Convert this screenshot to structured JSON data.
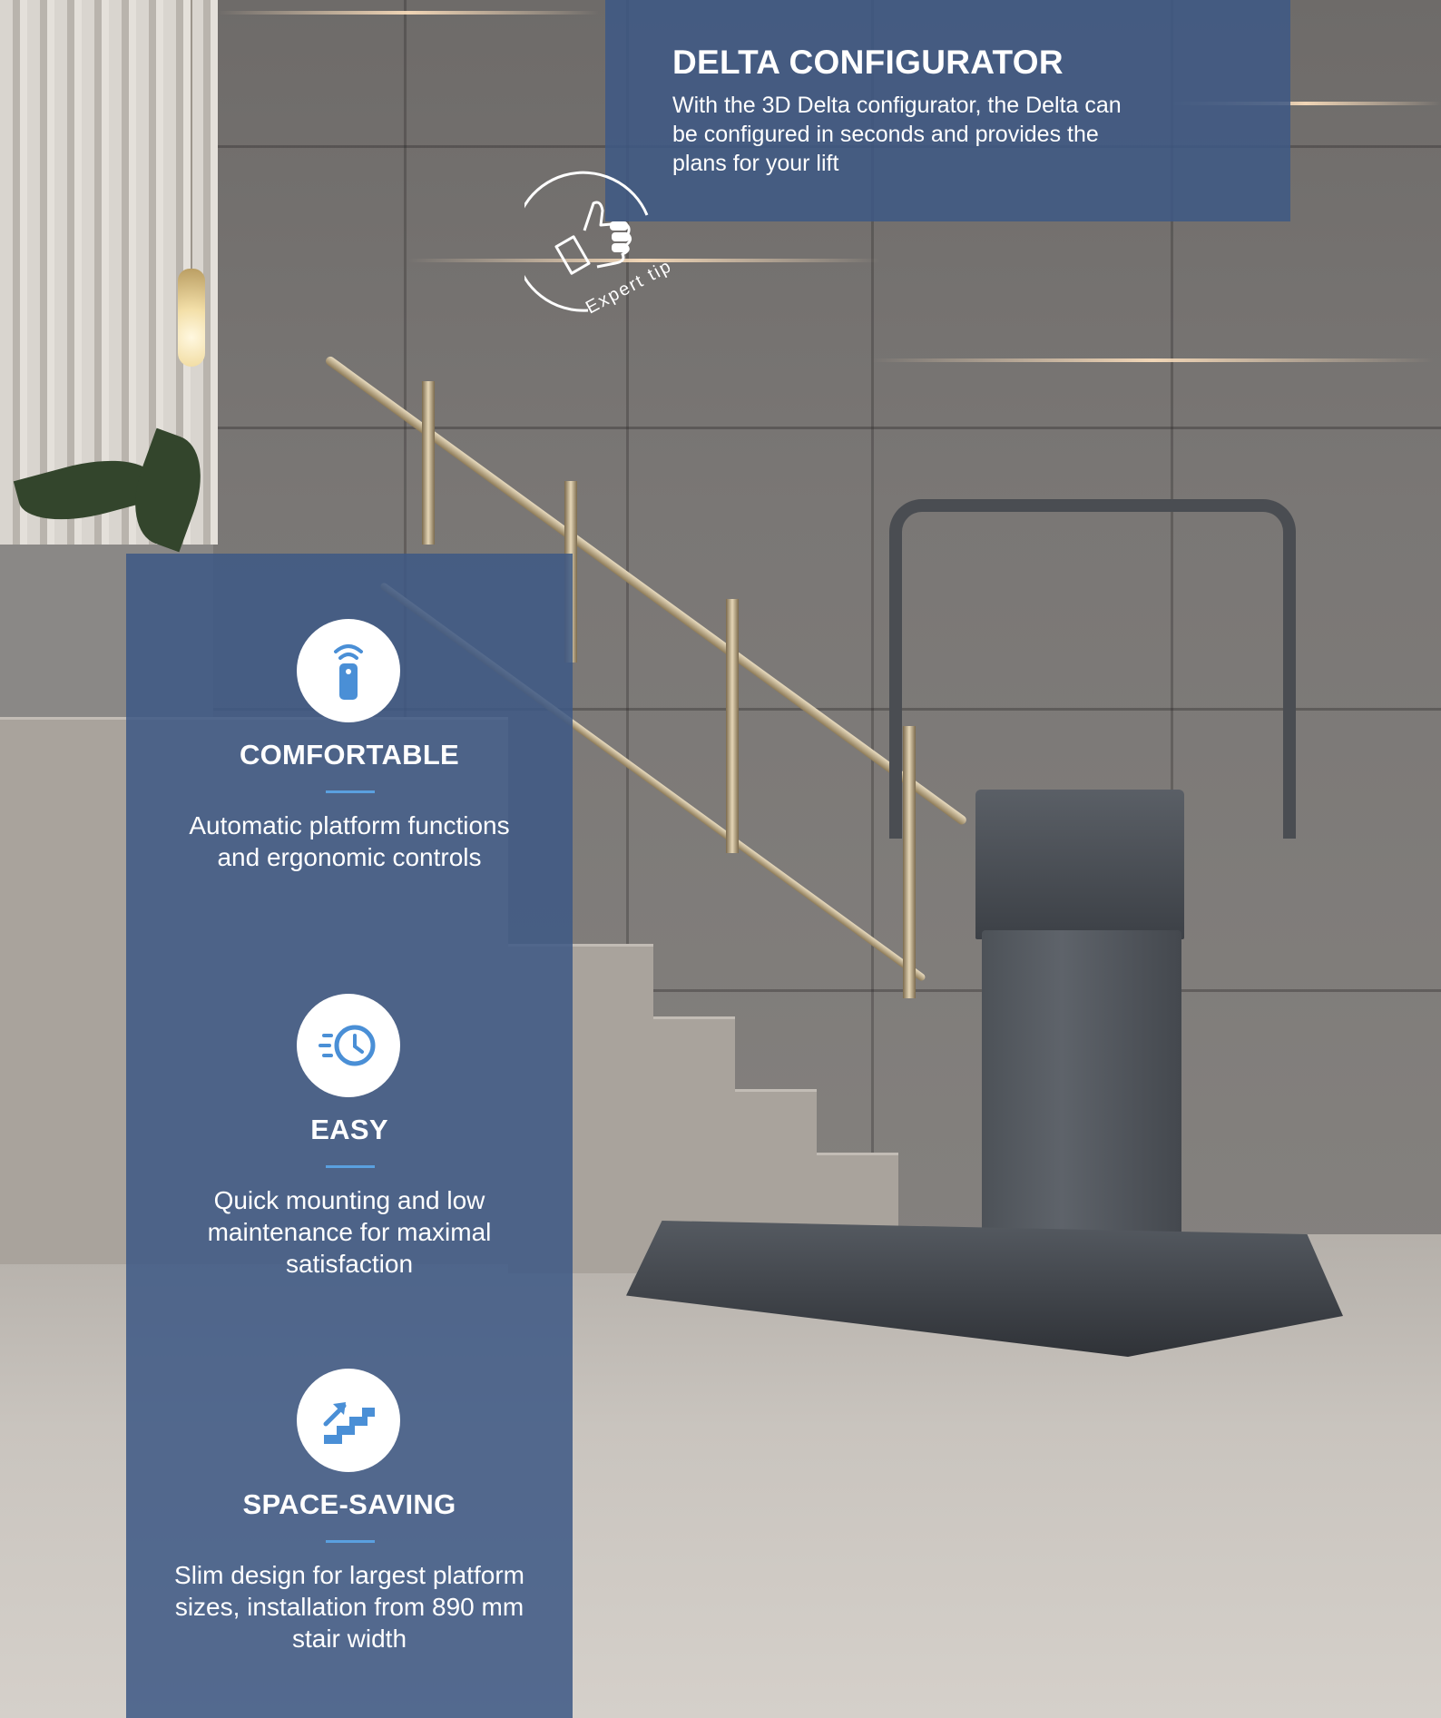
{
  "configurator": {
    "title": "DELTA CONFIGURATOR",
    "text": "With the 3D Delta configurator, the Delta can be configured in seconds and provides the plans for your lift"
  },
  "badge": {
    "label": "Expert tip",
    "icon": "thumbs-up-icon"
  },
  "features": [
    {
      "icon": "remote-control-icon",
      "title": "COMFORTABLE",
      "text": "Automatic platform functions and ergonomic controls"
    },
    {
      "icon": "fast-clock-icon",
      "title": "EASY",
      "text": "Quick mounting and low maintenance for maximal satisfaction"
    },
    {
      "icon": "stairs-arrow-icon",
      "title": "SPACE-SAVING",
      "text": "Slim design for largest platform sizes, installation from 890 mm stair width"
    }
  ],
  "colors": {
    "panel": "#3e5885",
    "accent": "#4a8fd6",
    "text": "#ffffff"
  }
}
